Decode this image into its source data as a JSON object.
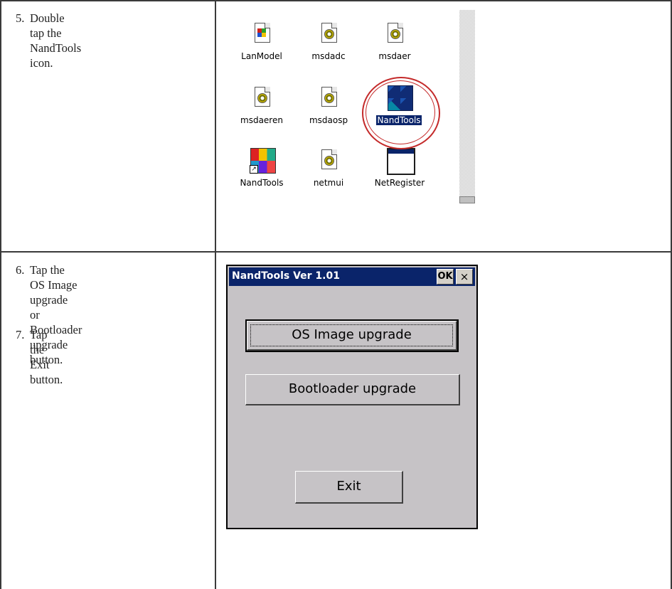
{
  "steps": [
    {
      "num": "5.",
      "lines": [
        "Double tap the NandTools",
        "icon."
      ]
    },
    {
      "num": "6.",
      "lines": [
        "Tap the OS Image upgrade",
        "or Bootloader upgrade",
        "button."
      ]
    },
    {
      "num": "7.",
      "lines": [
        "Tap the Exit button."
      ]
    }
  ],
  "explorer": {
    "files": [
      {
        "label": "LanModel",
        "icon": "setup-doc-icon"
      },
      {
        "label": "msdadc",
        "icon": "gear-doc-icon"
      },
      {
        "label": "msdaer",
        "icon": "gear-doc-icon"
      },
      {
        "label": "msdaeren",
        "icon": "gear-doc-icon"
      },
      {
        "label": "msdaosp",
        "icon": "gear-doc-icon"
      },
      {
        "label": "NandTools",
        "icon": "cubes-app-icon",
        "selected": true
      },
      {
        "label": "NandTools",
        "icon": "cubes-shortcut-icon"
      },
      {
        "label": "netmui",
        "icon": "gear-doc-icon"
      },
      {
        "label": "NetRegister",
        "icon": "window-app-icon"
      }
    ],
    "highlight_color": "#c42a2a",
    "selection_color": "#0a246a"
  },
  "dialog": {
    "title": "NandTools Ver 1.01",
    "ok_label": "OK",
    "close_label": "×",
    "buttons": {
      "os_image": "OS Image upgrade",
      "bootloader": "Bootloader upgrade",
      "exit": "Exit"
    },
    "title_bar_color": "#0a246a",
    "face_color": "#c6c3c6"
  }
}
